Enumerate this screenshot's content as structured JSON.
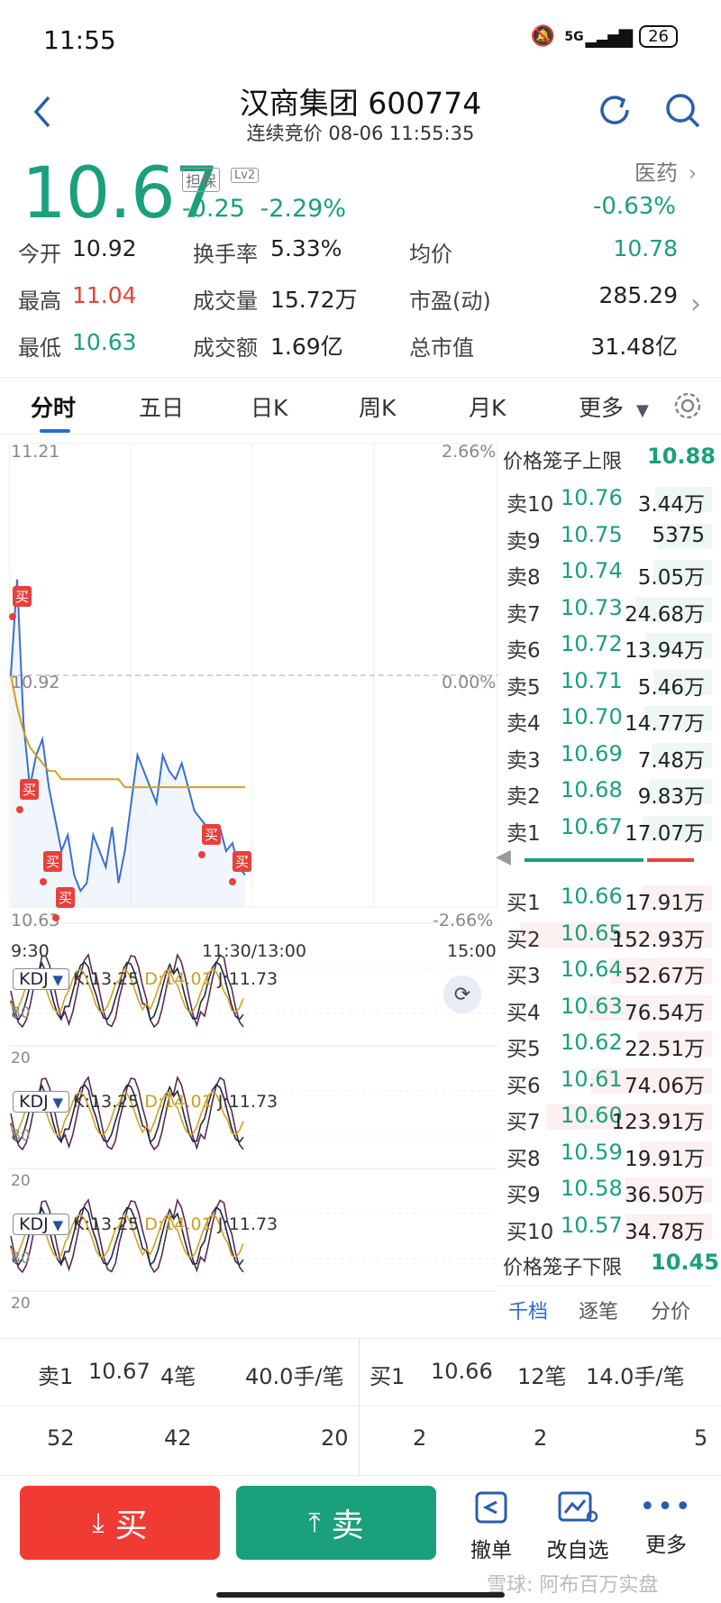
{
  "status": {
    "time": "11:55",
    "network": "5G",
    "battery": "26"
  },
  "header": {
    "title": "汉商集团 600774",
    "subtitle": "连续竞价 08-06 11:55:35"
  },
  "quote": {
    "price": "10.67",
    "tag_guarantee": "担保",
    "tag_lv2": "Lv2",
    "change": "-0.25",
    "change_pct": "-2.29%",
    "sector": "医药",
    "sector_change": "-0.63%"
  },
  "stats": [
    {
      "label": "今开",
      "value": "10.92",
      "color": "#222222"
    },
    {
      "label": "换手率",
      "value": "5.33%",
      "color": "#222222"
    },
    {
      "label": "均价",
      "value": "10.78",
      "color": "#1aa07a"
    },
    {
      "label": "最高",
      "value": "11.04",
      "color": "#e8413b"
    },
    {
      "label": "成交量",
      "value": "15.72万",
      "color": "#222222"
    },
    {
      "label": "市盈(动)",
      "value": "285.29",
      "color": "#222222"
    },
    {
      "label": "最低",
      "value": "10.63",
      "color": "#1aa07a"
    },
    {
      "label": "成交额",
      "value": "1.69亿",
      "color": "#222222"
    },
    {
      "label": "总市值",
      "value": "31.48亿",
      "color": "#222222"
    }
  ],
  "tabs": [
    "分时",
    "五日",
    "日K",
    "周K",
    "月K",
    "更多"
  ],
  "chart_axes": {
    "y_top": "11.21",
    "y_mid": "10.92",
    "y_bottom": "10.63",
    "pct_top": "2.66%",
    "pct_mid": "0.00%",
    "pct_bottom": "-2.66%",
    "x_start": "9:30",
    "x_mid": "11:30/13:00",
    "x_end": "15:00"
  },
  "buy_marker": "买",
  "kdj": {
    "label": "KDJ",
    "k": "K:13.25",
    "d": "D:14.01",
    "j": "J:11.73",
    "level_80": "80",
    "level_20": "20"
  },
  "chart_data": {
    "type": "line",
    "ylim": [
      10.63,
      11.21
    ],
    "series": [
      {
        "values": [
          10.92,
          11.04,
          10.86,
          10.78,
          10.82,
          10.84,
          10.78,
          10.74,
          10.7,
          10.72,
          10.67,
          10.65,
          10.66,
          10.72,
          10.7,
          10.68,
          10.73,
          10.66,
          10.7,
          10.76,
          10.82,
          10.8,
          10.78,
          10.76,
          10.82,
          10.8,
          10.79,
          10.81,
          10.78,
          10.75,
          10.74,
          10.73,
          10.72,
          10.73,
          10.7,
          10.71,
          10.68,
          10.67
        ]
      },
      {
        "values": [
          10.92,
          10.88,
          10.85,
          10.83,
          10.82,
          10.81,
          10.8,
          10.8,
          10.79,
          10.79,
          10.79,
          10.79,
          10.79,
          10.79,
          10.79,
          10.79,
          10.79,
          10.79,
          10.78,
          10.78,
          10.78,
          10.78,
          10.78,
          10.78,
          10.78,
          10.78,
          10.78,
          10.78,
          10.78,
          10.78,
          10.78,
          10.78,
          10.78,
          10.78,
          10.78,
          10.78,
          10.78,
          10.78
        ]
      }
    ]
  },
  "book": {
    "upper_limit_label": "价格笼子上限",
    "upper_limit": "10.88",
    "lower_limit_label": "价格笼子下限",
    "lower_limit": "10.45",
    "asks": [
      {
        "level": "卖10",
        "price": "10.76",
        "vol": "3.44万"
      },
      {
        "level": "卖9",
        "price": "10.75",
        "vol": "5375"
      },
      {
        "level": "卖8",
        "price": "10.74",
        "vol": "5.05万"
      },
      {
        "level": "卖7",
        "price": "10.73",
        "vol": "24.68万"
      },
      {
        "level": "卖6",
        "price": "10.72",
        "vol": "13.94万"
      },
      {
        "level": "卖5",
        "price": "10.71",
        "vol": "5.46万"
      },
      {
        "level": "卖4",
        "price": "10.70",
        "vol": "14.77万"
      },
      {
        "level": "卖3",
        "price": "10.69",
        "vol": "7.48万"
      },
      {
        "level": "卖2",
        "price": "10.68",
        "vol": "9.83万"
      },
      {
        "level": "卖1",
        "price": "10.67",
        "vol": "17.07万"
      }
    ],
    "bids": [
      {
        "level": "买1",
        "price": "10.66",
        "vol": "17.91万"
      },
      {
        "level": "买2",
        "price": "10.65",
        "vol": "152.93万"
      },
      {
        "level": "买3",
        "price": "10.64",
        "vol": "52.67万"
      },
      {
        "level": "买4",
        "price": "10.63",
        "vol": "76.54万"
      },
      {
        "level": "买5",
        "price": "10.62",
        "vol": "22.51万"
      },
      {
        "level": "买6",
        "price": "10.61",
        "vol": "74.06万"
      },
      {
        "level": "买7",
        "price": "10.60",
        "vol": "123.91万"
      },
      {
        "level": "买8",
        "price": "10.59",
        "vol": "19.91万"
      },
      {
        "level": "买9",
        "price": "10.58",
        "vol": "36.50万"
      },
      {
        "level": "买10",
        "price": "10.57",
        "vol": "34.78万"
      }
    ],
    "tabs": [
      "千档",
      "逐笔",
      "分价"
    ]
  },
  "trade_summary": {
    "sell": {
      "level": "卖1",
      "price": "10.67",
      "orders": "4笔",
      "avg": "40.0手/笔",
      "queue": [
        "52",
        "42",
        "20"
      ]
    },
    "buy": {
      "level": "买1",
      "price": "10.66",
      "orders": "12笔",
      "avg": "14.0手/笔",
      "queue": [
        "2",
        "2",
        "5"
      ]
    }
  },
  "actions": {
    "buy": "买",
    "sell": "卖",
    "cancel": "撤单",
    "edit_watchlist": "改自选",
    "more": "更多"
  },
  "watermark": "雪球: 阿布百万实盘",
  "colors": {
    "up": "#e8413b",
    "down": "#1aa07a",
    "price_line": "#3a6fd0",
    "avg_line": "#d4a020",
    "accent": "#2a6ad6"
  }
}
